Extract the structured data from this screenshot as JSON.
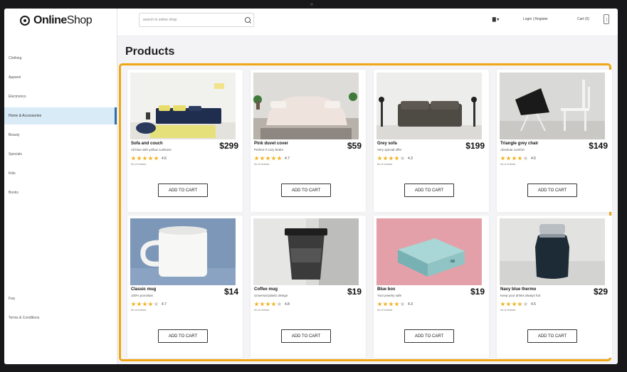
{
  "header": {
    "logo_bold": "Online",
    "logo_light": "Shop",
    "search_placeholder": "search in online shop",
    "flag": "▇ ▾",
    "account_link": "Login | Register",
    "cart_link": "Cart (0)"
  },
  "sidebar": {
    "items": [
      {
        "label": "Clothing"
      },
      {
        "label": "Apparel"
      },
      {
        "label": "Electronics"
      },
      {
        "label": "Home & Accessories",
        "active": true
      },
      {
        "label": "Beauty"
      },
      {
        "label": "Specials"
      },
      {
        "label": "Kids"
      },
      {
        "label": "Books"
      }
    ],
    "footer_items": [
      {
        "label": "Faq"
      },
      {
        "label": "Terms & Conditions"
      }
    ]
  },
  "page": {
    "title": "Products"
  },
  "buttons": {
    "add_to_cart": "ADD TO CART"
  },
  "colors": {
    "accent": "#f0a615",
    "active_nav": "#d9ebf6",
    "star": "#f2b01e"
  },
  "products": [
    {
      "name": "Sofa and couch",
      "subtitle": "All blue with yellow cushions",
      "price": "$299",
      "rating": "4.6",
      "stars": 5,
      "reviews": "No of reviews",
      "image": "blue-sofa-photo"
    },
    {
      "name": "Pink duvet cover",
      "subtitle": "Perfect # cozy bedrs",
      "price": "$59",
      "rating": "4.7",
      "stars": 5,
      "reviews": "No of reviews",
      "image": "pink-bed-photo"
    },
    {
      "name": "Grey sofa",
      "subtitle": "Very special offer",
      "price": "$199",
      "rating": "4.3",
      "stars": 4,
      "reviews": "No of reviews",
      "image": "grey-sofa-photo"
    },
    {
      "name": "Triangle grey chair",
      "subtitle": "Absolute comfort",
      "price": "$149",
      "rating": "4.6",
      "stars": 4,
      "reviews": "No of reviews",
      "image": "grey-chair-photo"
    },
    {
      "name": "Classic mug",
      "subtitle": "100% porcelain",
      "price": "$14",
      "rating": "4.7",
      "stars": 4,
      "reviews": "No of reviews",
      "image": "white-mug-photo"
    },
    {
      "name": "Coffee mug",
      "subtitle": "Universal plastic design",
      "price": "$19",
      "rating": "4.8",
      "stars": 4,
      "reviews": "No of reviews",
      "image": "coffee-cup-photo"
    },
    {
      "name": "Blue box",
      "subtitle": "Your jewelry safe",
      "price": "$19",
      "rating": "4.3",
      "stars": 4,
      "reviews": "No of reviews",
      "image": "blue-box-photo"
    },
    {
      "name": "Navy blue thermo",
      "subtitle": "Keep your drinks always hot",
      "price": "$29",
      "rating": "4.5",
      "stars": 4,
      "reviews": "No of reviews",
      "image": "thermo-photo"
    }
  ]
}
